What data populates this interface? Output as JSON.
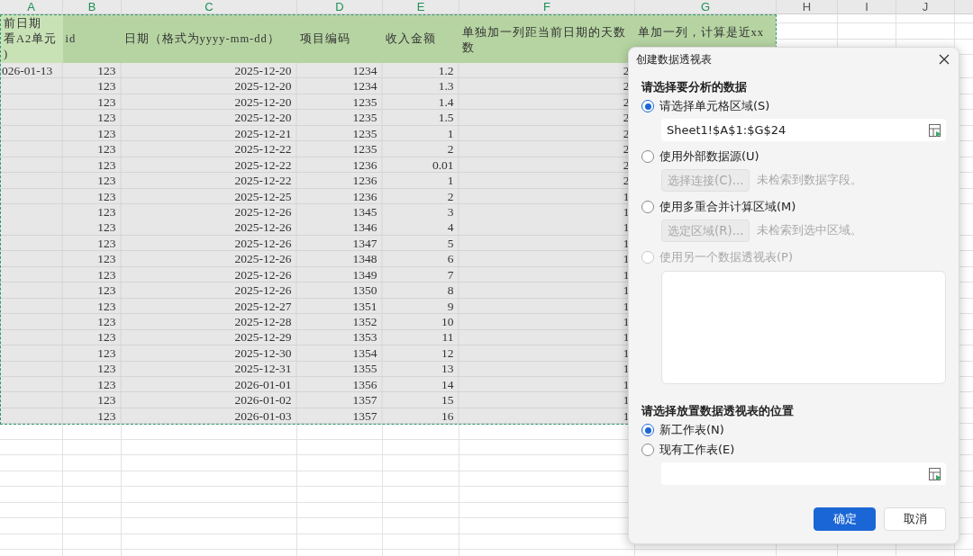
{
  "column_headers": [
    {
      "label": "A",
      "selected": true
    },
    {
      "label": "B",
      "selected": true
    },
    {
      "label": "C",
      "selected": true
    },
    {
      "label": "D",
      "selected": true
    },
    {
      "label": "E",
      "selected": true
    },
    {
      "label": "F",
      "selected": true
    },
    {
      "label": "G",
      "selected": true
    },
    {
      "label": "H",
      "selected": false
    },
    {
      "label": "I",
      "selected": false
    },
    {
      "label": "J",
      "selected": false
    }
  ],
  "table": {
    "header": [
      [
        "前日期",
        "看A2单元",
        ")"
      ],
      [
        "id"
      ],
      [
        "日期（格式为yyyy-mm-dd）"
      ],
      [
        "项目编码"
      ],
      [
        "收入金额"
      ],
      [
        "单独加一列距当前日期的天数",
        "数"
      ],
      [
        "单加一列，计算是近xx"
      ]
    ],
    "rows": [
      [
        "026-01-13",
        "123",
        "2025-12-20",
        "1234",
        "1.2",
        "2"
      ],
      [
        "",
        "123",
        "2025-12-20",
        "1234",
        "1.3",
        "2"
      ],
      [
        "",
        "123",
        "2025-12-20",
        "1235",
        "1.4",
        "2"
      ],
      [
        "",
        "123",
        "2025-12-20",
        "1235",
        "1.5",
        "2"
      ],
      [
        "",
        "123",
        "2025-12-21",
        "1235",
        "1",
        "2"
      ],
      [
        "",
        "123",
        "2025-12-22",
        "1235",
        "2",
        "2"
      ],
      [
        "",
        "123",
        "2025-12-22",
        "1236",
        "0.01",
        "2"
      ],
      [
        "",
        "123",
        "2025-12-22",
        "1236",
        "1",
        "2"
      ],
      [
        "",
        "123",
        "2025-12-25",
        "1236",
        "2",
        "1"
      ],
      [
        "",
        "123",
        "2025-12-26",
        "1345",
        "3",
        "1"
      ],
      [
        "",
        "123",
        "2025-12-26",
        "1346",
        "4",
        "1"
      ],
      [
        "",
        "123",
        "2025-12-26",
        "1347",
        "5",
        "1"
      ],
      [
        "",
        "123",
        "2025-12-26",
        "1348",
        "6",
        "1"
      ],
      [
        "",
        "123",
        "2025-12-26",
        "1349",
        "7",
        "1"
      ],
      [
        "",
        "123",
        "2025-12-26",
        "1350",
        "8",
        "1"
      ],
      [
        "",
        "123",
        "2025-12-27",
        "1351",
        "9",
        "1"
      ],
      [
        "",
        "123",
        "2025-12-28",
        "1352",
        "10",
        "1"
      ],
      [
        "",
        "123",
        "2025-12-29",
        "1353",
        "11",
        "1"
      ],
      [
        "",
        "123",
        "2025-12-30",
        "1354",
        "12",
        "1"
      ],
      [
        "",
        "123",
        "2025-12-31",
        "1355",
        "13",
        "1"
      ],
      [
        "",
        "123",
        "2026-01-01",
        "1356",
        "14",
        "1"
      ],
      [
        "",
        "123",
        "2026-01-02",
        "1357",
        "15",
        "1"
      ],
      [
        "",
        "123",
        "2026-01-03",
        "1357",
        "16",
        "1"
      ]
    ]
  },
  "dialog": {
    "title": "创建数据透视表",
    "source": {
      "heading": "请选择要分析的数据",
      "options": [
        {
          "label": "请选择单元格区域(S)",
          "selected": true,
          "disabled": false,
          "kind": "field",
          "value": "Sheet1!$A$1:$G$24"
        },
        {
          "label": "使用外部数据源(U)",
          "selected": false,
          "disabled": false,
          "kind": "button",
          "button": "选择连接(C)...",
          "note": "未检索到数据字段。"
        },
        {
          "label": "使用多重合并计算区域(M)",
          "selected": false,
          "disabled": false,
          "kind": "button",
          "button": "选定区域(R)...",
          "note": "未检索到选中区域。"
        },
        {
          "label": "使用另一个数据透视表(P)",
          "selected": false,
          "disabled": true,
          "kind": "list"
        }
      ]
    },
    "target": {
      "heading": "请选择放置数据透视表的位置",
      "options": [
        {
          "label": "新工作表(N)",
          "selected": true,
          "disabled": false,
          "kind": "plain"
        },
        {
          "label": "现有工作表(E)",
          "selected": false,
          "disabled": false,
          "kind": "field"
        }
      ]
    },
    "buttons": [
      {
        "label": "确定",
        "kind": "primary"
      },
      {
        "label": "取消",
        "kind": "secondary"
      }
    ]
  }
}
